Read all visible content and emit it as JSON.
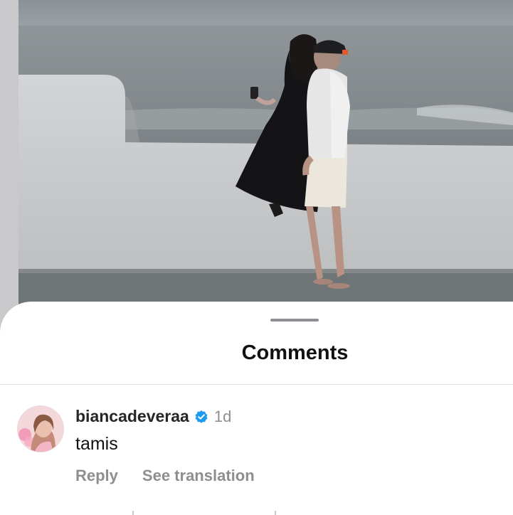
{
  "photo": {
    "description_icon": "beach-couple-photo"
  },
  "sheet": {
    "title": "Comments"
  },
  "comment": {
    "username": "biancadeveraa",
    "verified_icon": "verified-badge-icon",
    "time": "1d",
    "text": "tamis",
    "reply_label": "Reply",
    "translate_label": "See translation"
  },
  "colors": {
    "verified": "#1d9bf0",
    "meta": "#8e8e8e",
    "title": "#111111"
  }
}
